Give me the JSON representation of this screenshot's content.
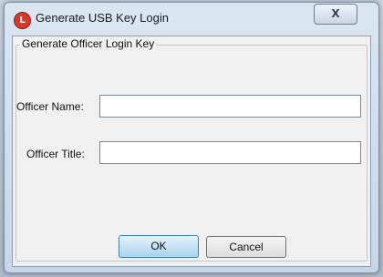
{
  "window": {
    "title": "Generate USB Key Login",
    "app_icon_glyph": "L",
    "close_glyph": "X"
  },
  "group": {
    "legend": "Generate Officer Login Key"
  },
  "form": {
    "officer_name_label": "Officer Name:",
    "officer_name_value": "",
    "officer_title_label": "Officer Title:",
    "officer_title_value": ""
  },
  "buttons": {
    "ok_label": "OK",
    "cancel_label": "Cancel"
  },
  "colors": {
    "app_icon": "#d9372a",
    "ok_button_border": "#3c7fb1"
  }
}
